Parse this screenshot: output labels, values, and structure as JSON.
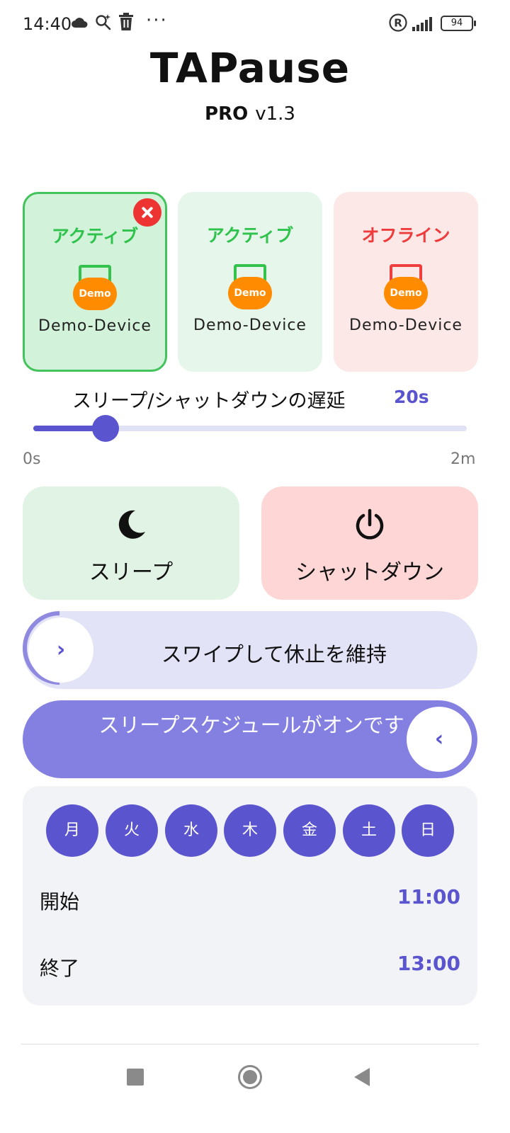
{
  "status_bar": {
    "time": "14:40",
    "battery": "94",
    "dots": "···"
  },
  "header": {
    "title": "TAPause",
    "pro": "PRO",
    "version": "v1.3"
  },
  "devices": [
    {
      "status": "アクティブ",
      "name": "Demo-Device",
      "badge": "Demo",
      "state": "active",
      "selected": true
    },
    {
      "status": "アクティブ",
      "name": "Demo-Device",
      "badge": "Demo",
      "state": "active",
      "selected": false
    },
    {
      "status": "オフライン",
      "name": "Demo-Device",
      "badge": "Demo",
      "state": "offline",
      "selected": false
    }
  ],
  "delay": {
    "label": "スリープ/シャットダウンの遅延",
    "value": "20s",
    "min_label": "0s",
    "max_label": "2m",
    "seconds": 20,
    "max_seconds": 120
  },
  "actions": {
    "sleep_label": "スリープ",
    "shutdown_label": "シャットダウン"
  },
  "swipe_keep": {
    "text": "スワイプして休止を維持",
    "chevron": "›"
  },
  "swipe_schedule": {
    "text": "スリープスケジュールがオンです",
    "chevron": "‹"
  },
  "schedule": {
    "days": [
      "月",
      "火",
      "水",
      "木",
      "金",
      "土",
      "日"
    ],
    "start_label": "開始",
    "start_time": "11:00",
    "end_label": "終了",
    "end_time": "13:00"
  },
  "colors": {
    "accent": "#5b54cf",
    "active": "#2fc24c",
    "offline": "#ee3c3c",
    "badge": "#ff8c00"
  }
}
